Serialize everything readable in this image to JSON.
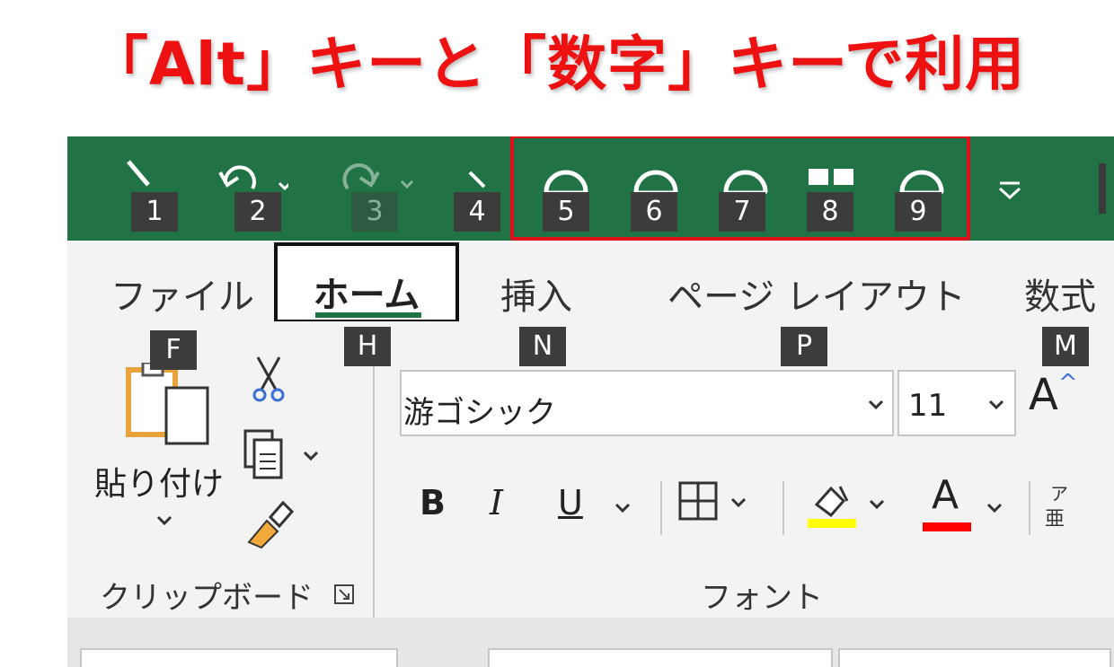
{
  "headline": "「Alt」キーと「数字」キーで利用",
  "quick_access": {
    "keytips": [
      "1",
      "2",
      "3",
      "4",
      "5",
      "6",
      "7",
      "8",
      "9"
    ]
  },
  "tabs": {
    "file": {
      "label": "ファイル",
      "keytip": "F"
    },
    "home": {
      "label": "ホーム",
      "keytip": "H"
    },
    "insert": {
      "label": "挿入",
      "keytip": "N"
    },
    "page_layout": {
      "label": "ページ レイアウト",
      "keytip": "P"
    },
    "formulas": {
      "label": "数式",
      "keytip": "M"
    }
  },
  "clipboard": {
    "paste_label": "貼り付け",
    "group_label": "クリップボード"
  },
  "font": {
    "name": "游ゴシック",
    "size": "11",
    "group_label": "フォント",
    "bold": "B",
    "italic": "I",
    "underline": "U",
    "font_color_letter": "A",
    "grow_letter": "A",
    "phonetic_top": "ア",
    "phonetic_bottom": "亜"
  },
  "colors": {
    "title_bar": "#217346",
    "highlight": "#e0101a",
    "highlight_color_bar": "#ffff00",
    "font_color_bar": "#ff0000"
  }
}
